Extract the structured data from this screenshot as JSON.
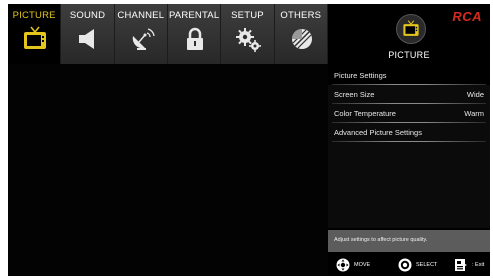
{
  "tabs": [
    {
      "label": "PICTURE",
      "icon": "tv-icon",
      "active": true
    },
    {
      "label": "SOUND",
      "icon": "speaker-icon",
      "active": false
    },
    {
      "label": "CHANNEL",
      "icon": "satellite-dish-icon",
      "active": false
    },
    {
      "label": "PARENTAL",
      "icon": "padlock-icon",
      "active": false
    },
    {
      "label": "SETUP",
      "icon": "gears-icon",
      "active": false
    },
    {
      "label": "OTHERS",
      "icon": "others-icon",
      "active": false
    }
  ],
  "brand": "RCA",
  "header": {
    "title": "PICTURE",
    "icon": "tv-icon"
  },
  "menu": {
    "heading": "Picture Settings",
    "items": [
      {
        "label": "Screen Size",
        "value": "Wide"
      },
      {
        "label": "Color Temperature",
        "value": "Warm"
      },
      {
        "label": "Advanced Picture Settings",
        "value": ""
      }
    ]
  },
  "help_text": "Adjust settings to affect picture quality.",
  "hints": [
    {
      "label": "MOVE",
      "icon": "dpad-icon"
    },
    {
      "label": "SELECT",
      "icon": "ok-button-icon"
    },
    {
      "label": ": Exit",
      "icon": "exit-icon"
    }
  ],
  "colors": {
    "active_tab_text": "#e3c51d",
    "brand": "#d52b1e",
    "screen_bg": "#000000"
  }
}
